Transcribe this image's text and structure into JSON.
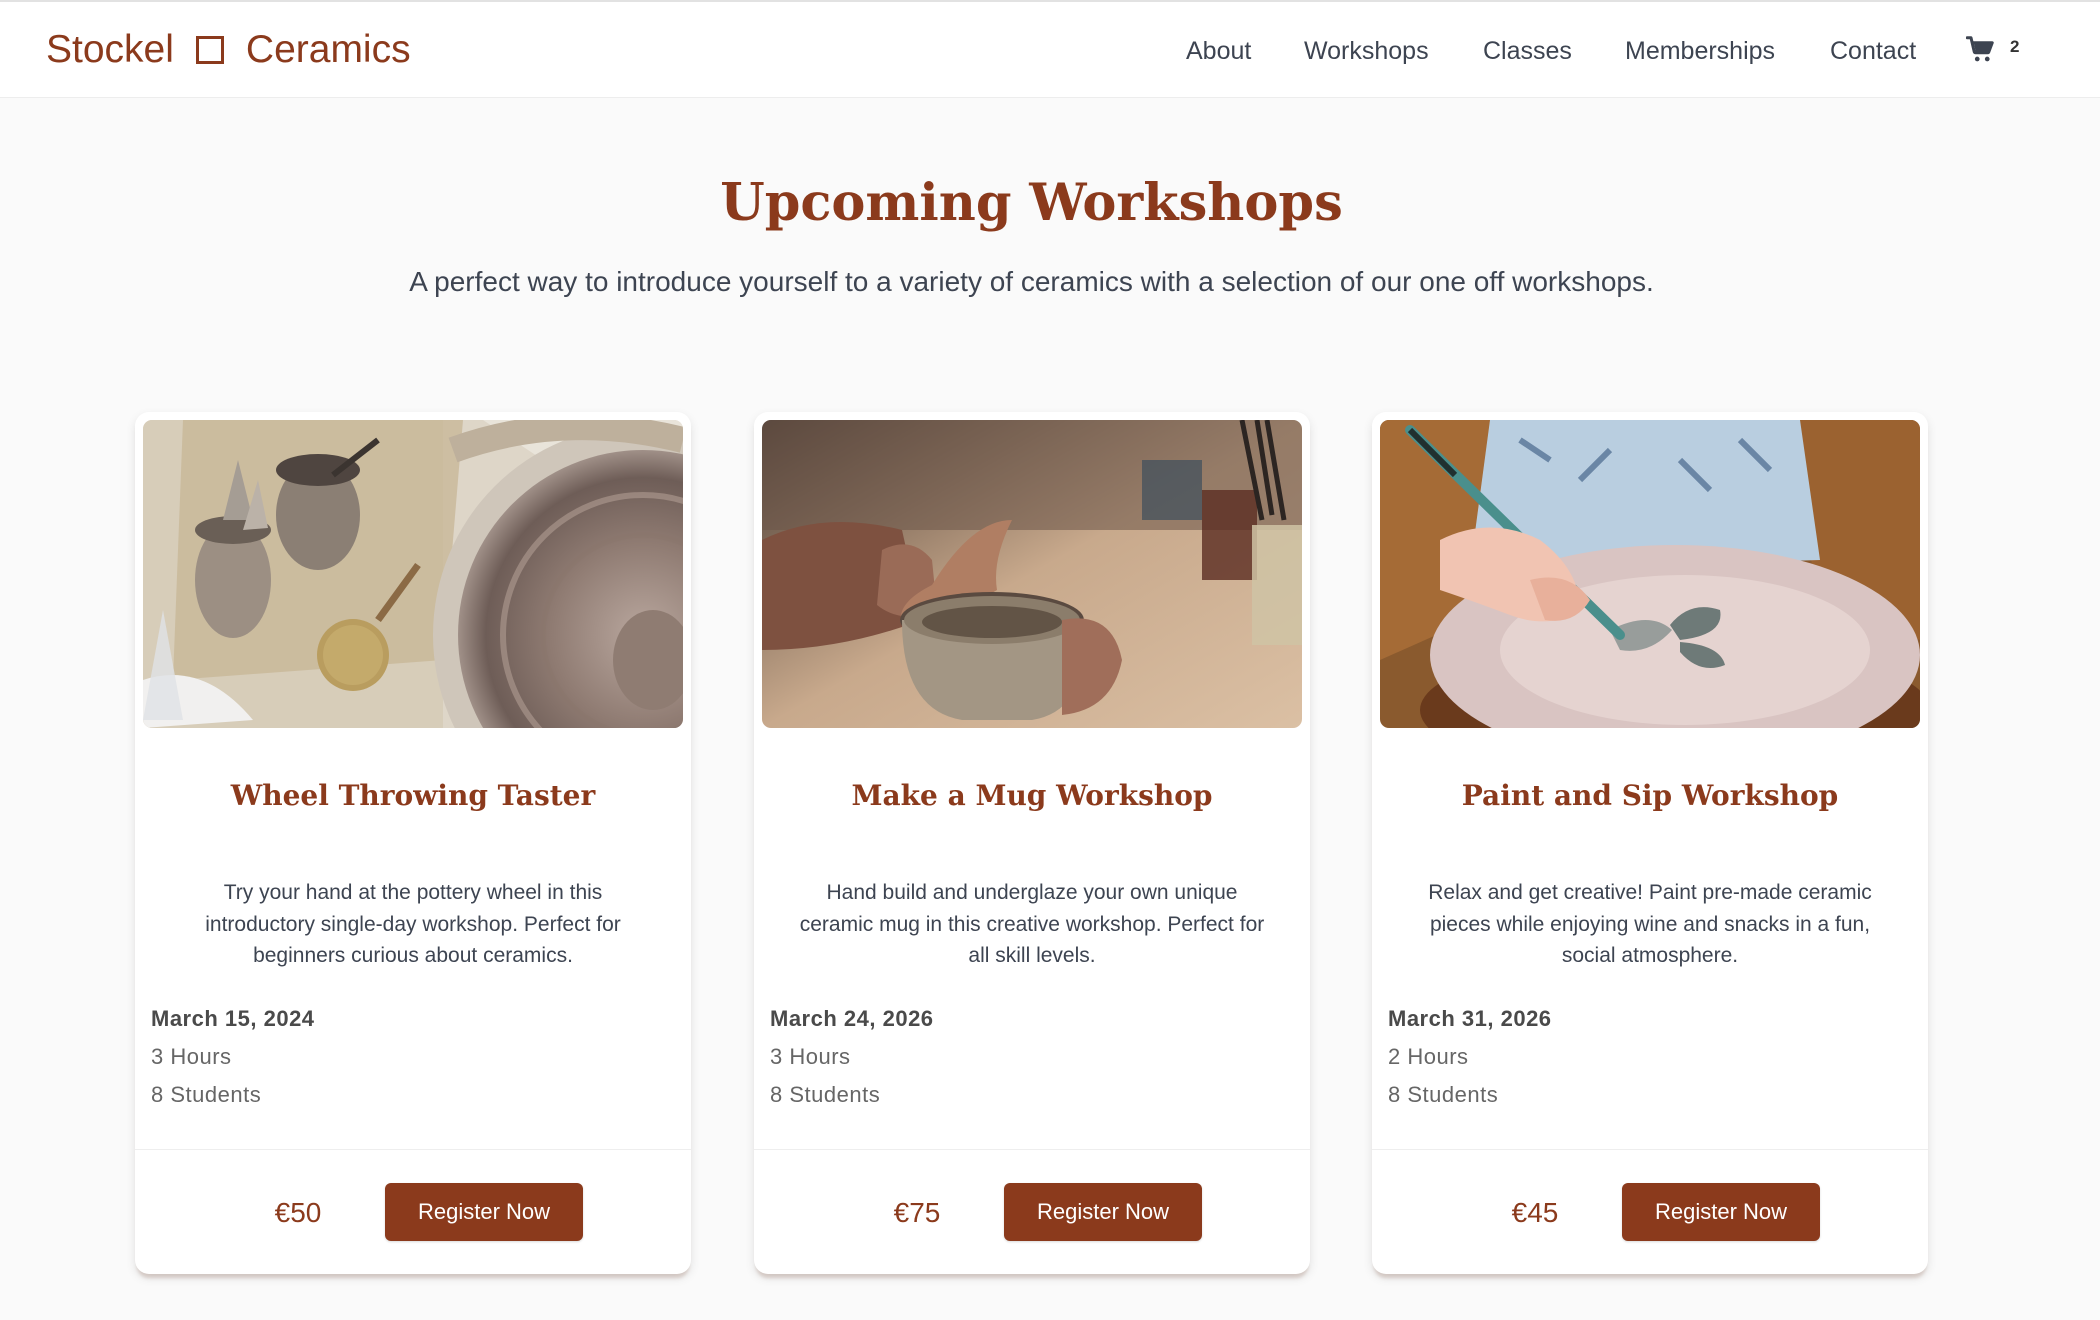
{
  "brand": {
    "name_left": "Stockel",
    "name_right": "Ceramics",
    "color": "#8b3a1c"
  },
  "nav": {
    "items": [
      "About",
      "Workshops",
      "Classes",
      "Memberships",
      "Contact"
    ],
    "cart_icon": "shopping-cart-icon",
    "cart_count": "2"
  },
  "hero": {
    "title": "Upcoming Workshops",
    "subtitle": "A perfect way to introduce yourself to a variety of ceramics with a selection of our one off workshops."
  },
  "workshops": [
    {
      "title": "Wheel Throwing Taster",
      "description": "Try your hand at the pottery wheel in this introductory single-day workshop. Perfect for beginners curious about ceramics.",
      "date": "March 15, 2024",
      "duration": "3 Hours",
      "students": "8 Students",
      "price": "€50",
      "button": "Register Now",
      "image": "pottery-wheel-photo"
    },
    {
      "title": "Make a Mug Workshop",
      "description": "Hand build and underglaze your own unique ceramic mug in this creative workshop. Perfect for all skill levels.",
      "date": "March 24, 2026",
      "duration": "3 Hours",
      "students": "8 Students",
      "price": "€75",
      "button": "Register Now",
      "image": "hand-building-mug-photo"
    },
    {
      "title": "Paint and Sip Workshop",
      "description": "Relax and get creative! Paint pre-made ceramic pieces while enjoying wine and snacks in a fun, social atmosphere.",
      "date": "March 31, 2026",
      "duration": "2 Hours",
      "students": "8 Students",
      "price": "€45",
      "button": "Register Now",
      "image": "painting-plate-photo"
    }
  ]
}
